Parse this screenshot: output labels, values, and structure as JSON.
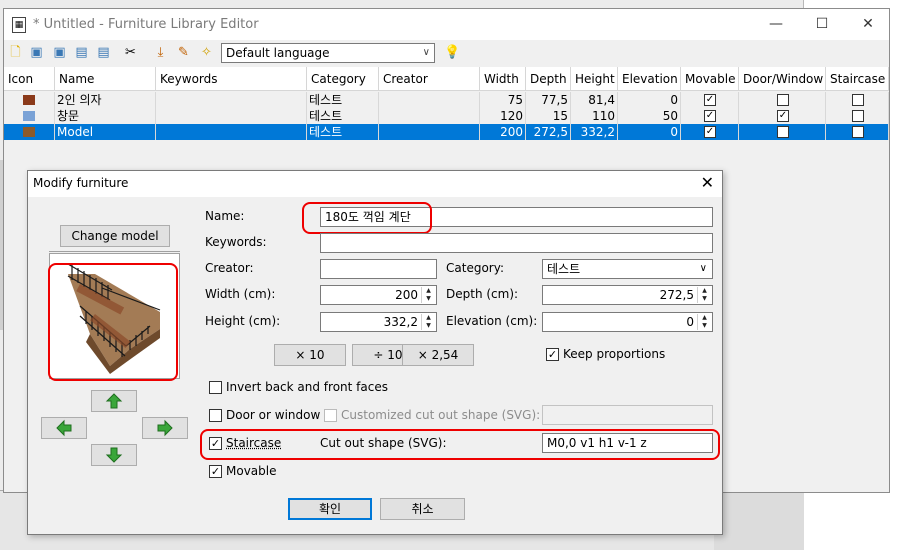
{
  "window": {
    "title": "* Untitled - Furniture Library Editor",
    "minimize": "—",
    "maximize": "☐",
    "close": "✕"
  },
  "toolbar": {
    "language": "Default language"
  },
  "table": {
    "headers": [
      "Icon",
      "Name",
      "Keywords",
      "Category",
      "Creator",
      "Width",
      "Depth",
      "Height",
      "Elevation",
      "Movable",
      "Door/Window",
      "Staircase"
    ],
    "rows": [
      {
        "name": "2인 의자",
        "keywords": "",
        "category": "테스트",
        "creator": "",
        "width": "75",
        "depth": "77,5",
        "height": "81,4",
        "elevation": "0",
        "movable": true,
        "door": false,
        "stair": false,
        "selected": false
      },
      {
        "name": "창문",
        "keywords": "",
        "category": "테스트",
        "creator": "",
        "width": "120",
        "depth": "15",
        "height": "110",
        "elevation": "50",
        "movable": true,
        "door": true,
        "stair": false,
        "selected": false
      },
      {
        "name": "Model",
        "keywords": "",
        "category": "테스트",
        "creator": "",
        "width": "200",
        "depth": "272,5",
        "height": "332,2",
        "elevation": "0",
        "movable": true,
        "door": false,
        "stair": false,
        "selected": true
      }
    ]
  },
  "dialog": {
    "title": "Modify furniture",
    "change_model": "Change model",
    "name_label": "Name:",
    "name_value": "180도 꺽임 계단",
    "keywords_label": "Keywords:",
    "keywords_value": "",
    "creator_label": "Creator:",
    "creator_value": "",
    "category_label": "Category:",
    "category_value": "테스트",
    "width_label": "Width (cm):",
    "width_value": "200",
    "depth_label": "Depth (cm):",
    "depth_value": "272,5",
    "height_label": "Height (cm):",
    "height_value": "332,2",
    "elevation_label": "Elevation (cm):",
    "elevation_value": "0",
    "mult10": "× 10",
    "div10": "÷ 10",
    "mult254": "× 2,54",
    "keep_proportions": "Keep proportions",
    "invert_faces": "Invert back and front faces",
    "door_window": "Door or window",
    "custom_cut": "Customized cut out shape (SVG):",
    "staircase": "Staircase",
    "cut_out_label": "Cut out shape (SVG):",
    "cut_out_value": "M0,0 v1 h1 v-1 z",
    "movable": "Movable",
    "ok": "확인",
    "cancel": "취소"
  }
}
